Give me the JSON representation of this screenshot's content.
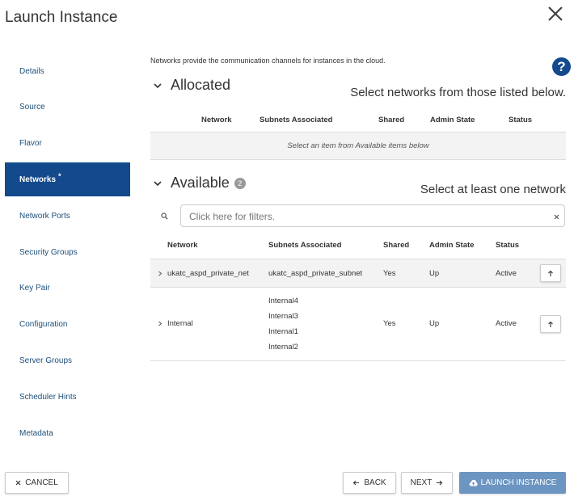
{
  "dialog": {
    "title": "Launch Instance"
  },
  "sidebar": {
    "items": [
      {
        "label": "Details"
      },
      {
        "label": "Source"
      },
      {
        "label": "Flavor"
      },
      {
        "label": "Networks",
        "marker": "*"
      },
      {
        "label": "Network Ports"
      },
      {
        "label": "Security Groups"
      },
      {
        "label": "Key Pair"
      },
      {
        "label": "Configuration"
      },
      {
        "label": "Server Groups"
      },
      {
        "label": "Scheduler Hints"
      },
      {
        "label": "Metadata"
      }
    ],
    "active_index": 3
  },
  "main": {
    "intro": "Networks provide the communication channels for instances in the cloud.",
    "help_label": "?",
    "allocated": {
      "heading": "Allocated",
      "hint": "Select networks from those listed below.",
      "columns": [
        "Network",
        "Subnets Associated",
        "Shared",
        "Admin State",
        "Status"
      ],
      "empty_text": "Select an item from Available items below"
    },
    "available": {
      "heading": "Available",
      "count": "2",
      "hint": "Select at least one network",
      "filter_placeholder": "Click here for filters.",
      "columns": [
        "Network",
        "Subnets Associated",
        "Shared",
        "Admin State",
        "Status"
      ],
      "rows": [
        {
          "network": "ukatc_aspd_private_net",
          "subnets": [
            "ukatc_aspd_private_subnet"
          ],
          "shared": "Yes",
          "admin_state": "Up",
          "status": "Active"
        },
        {
          "network": "Internal",
          "subnets": [
            "Internal4",
            "Internal3",
            "Internal1",
            "Internal2"
          ],
          "shared": "Yes",
          "admin_state": "Up",
          "status": "Active"
        }
      ]
    }
  },
  "footer": {
    "cancel_label": "CANCEL",
    "back_label": "BACK",
    "next_label": "NEXT",
    "launch_label": "LAUNCH INSTANCE"
  },
  "colors": {
    "accent": "#134a8c",
    "launch_button": "#6c95c1",
    "link": "#1d4f7a"
  }
}
